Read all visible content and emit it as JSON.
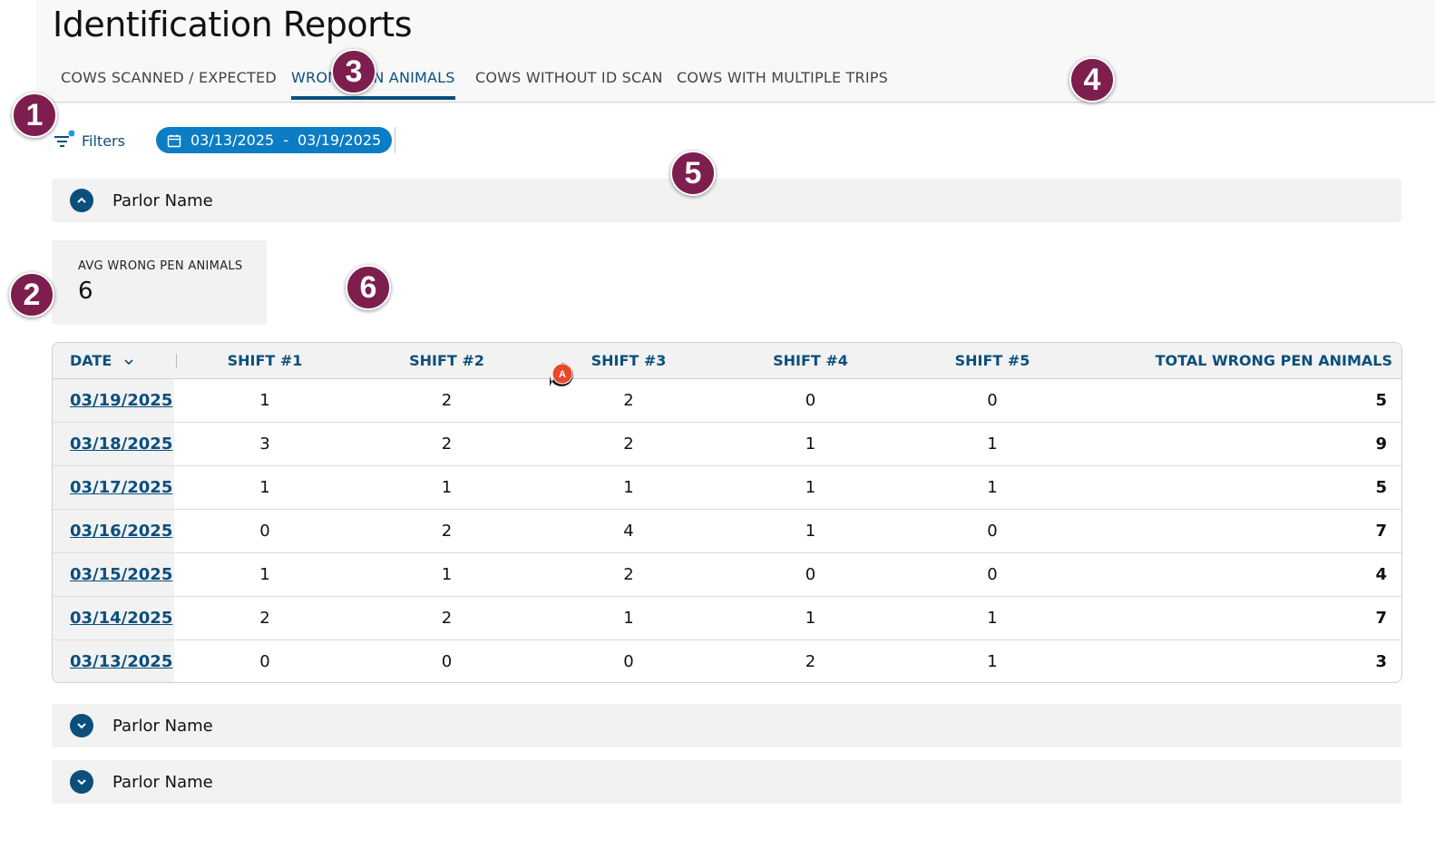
{
  "page": {
    "title": "Identification Reports"
  },
  "tabs": [
    {
      "label": "COWS SCANNED / EXPECTED",
      "active": false
    },
    {
      "label": "WRONG PEN ANIMALS",
      "active": true
    },
    {
      "label": "COWS WITHOUT ID SCAN",
      "active": false
    },
    {
      "label": "COWS WITH MULTIPLE TRIPS",
      "active": false
    }
  ],
  "filters": {
    "label": "Filters",
    "icon": "filter-icon",
    "has_active_dot": true
  },
  "date_range": {
    "icon": "calendar-icon",
    "start": "03/13/2025",
    "separator": "-",
    "end": "03/19/2025"
  },
  "accordions": [
    {
      "label": "Parlor Name",
      "expanded": true,
      "icon": "chevron-up-icon"
    },
    {
      "label": "Parlor Name",
      "expanded": false,
      "icon": "chevron-down-icon"
    },
    {
      "label": "Parlor Name",
      "expanded": false,
      "icon": "chevron-down-icon"
    }
  ],
  "kpi": {
    "label": "AVG WRONG PEN ANIMALS",
    "value": "6"
  },
  "table": {
    "columns": [
      "DATE",
      "SHIFT #1",
      "SHIFT #2",
      "SHIFT #3",
      "SHIFT #4",
      "SHIFT #5",
      "TOTAL WRONG PEN ANIMALS"
    ],
    "sort_icon": "chevron-down-icon",
    "rows": [
      [
        "03/19/2025",
        "1",
        "2",
        "2",
        "0",
        "0",
        "5"
      ],
      [
        "03/18/2025",
        "3",
        "2",
        "2",
        "1",
        "1",
        "9"
      ],
      [
        "03/17/2025",
        "1",
        "1",
        "1",
        "1",
        "1",
        "5"
      ],
      [
        "03/16/2025",
        "0",
        "2",
        "4",
        "1",
        "0",
        "7"
      ],
      [
        "03/15/2025",
        "1",
        "1",
        "2",
        "0",
        "0",
        "4"
      ],
      [
        "03/14/2025",
        "2",
        "2",
        "1",
        "1",
        "1",
        "7"
      ],
      [
        "03/13/2025",
        "0",
        "0",
        "0",
        "2",
        "1",
        "3"
      ]
    ]
  },
  "annotations": {
    "markers": [
      "1",
      "2",
      "3",
      "4",
      "5",
      "6"
    ],
    "cursor_label": "A"
  },
  "colors": {
    "accent": "#0b4f7c",
    "chip": "#0b7dc4",
    "marker": "#7d1e4e",
    "cursor": "#e8472b",
    "panel": "#f2f2f2"
  }
}
